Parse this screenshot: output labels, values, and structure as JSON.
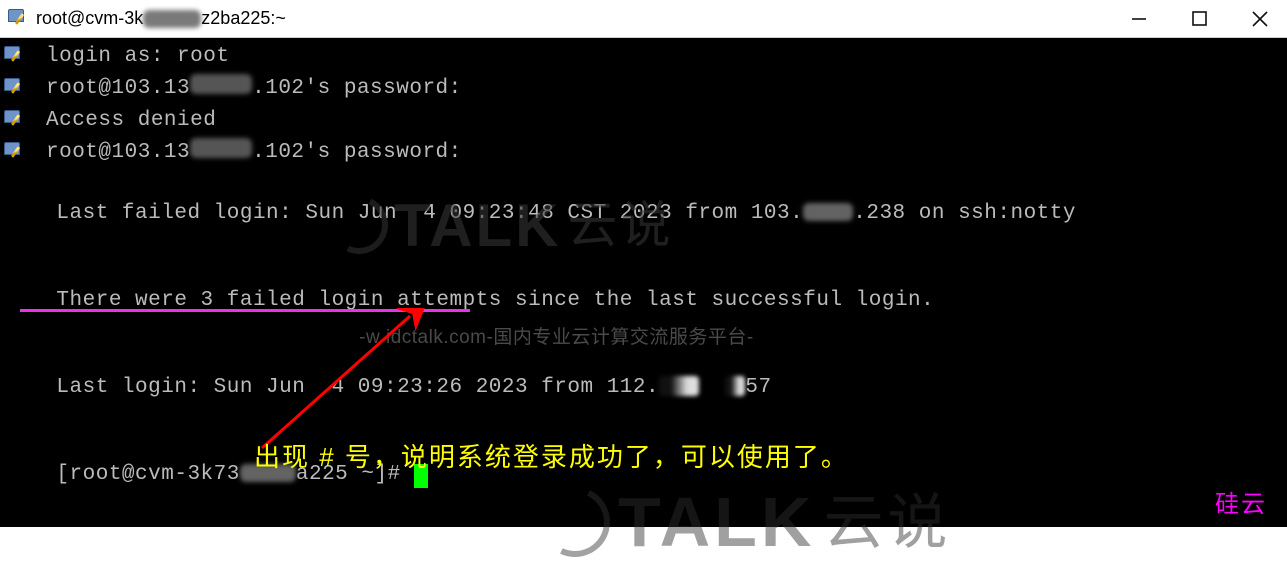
{
  "titlebar": {
    "icon": "putty-icon",
    "title_prefix": "root@cvm-3k",
    "title_suffix": "z2ba225:~"
  },
  "terminal": {
    "lines": [
      {
        "icon": true,
        "text": "login as: root"
      },
      {
        "icon": true,
        "prefix": "root@103.13",
        "suffix": ".102's password:"
      },
      {
        "icon": true,
        "text": "Access denied"
      },
      {
        "icon": true,
        "prefix": "root@103.13",
        "suffix": ".102's password:"
      },
      {
        "icon": false,
        "prefix": "Last failed login: Sun Jun  4 09:23:48 CST 2023 from 103.",
        "suffix": ".238 on ssh:notty"
      },
      {
        "icon": false,
        "text": "There were 3 failed login attempts since the last successful login."
      },
      {
        "icon": false,
        "prefix": "Last login: Sun Jun  4 09:23:26 2023 from 112.",
        "suffix": "57"
      },
      {
        "icon": false,
        "prompt_prefix": "[root@cvm-3k73",
        "prompt_suffix": "a225 ~]# ",
        "cursor": true
      }
    ]
  },
  "annotation": {
    "text": "出现 # 号，说明系统登录成功了，可以使用了。"
  },
  "watermark": {
    "swirl": "◯",
    "brand_en": "TALK",
    "brand_cn": "云说",
    "url_line_prefix": "-w",
    "url_line_core": "idctalk.com",
    "url_line_suffix": "-国内专业云计算交流服务平台-"
  },
  "brand_corner": "硅云"
}
